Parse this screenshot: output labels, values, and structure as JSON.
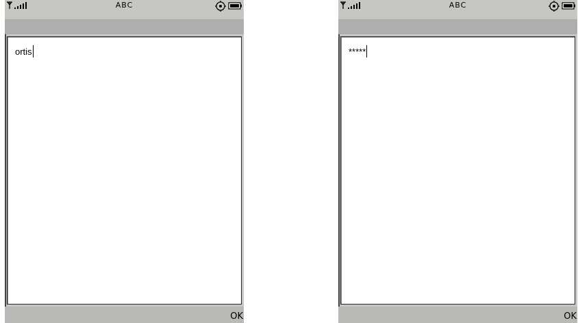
{
  "screens": [
    {
      "status": {
        "mode": "ABC"
      },
      "editor": {
        "text": "ortis"
      },
      "softkeys": {
        "right": "OK"
      }
    },
    {
      "status": {
        "mode": "ABC"
      },
      "editor": {
        "text": "*****"
      },
      "softkeys": {
        "right": "OK"
      }
    }
  ],
  "icons": {
    "signal": "signal-strength-icon",
    "settings": "settings-gear-icon",
    "battery": "battery-icon"
  },
  "colors": {
    "chrome": "#c4c8c0",
    "title_bar": "#aeaeae",
    "softkey_bar": "#b9bab6",
    "editor_bg": "#ffffff"
  }
}
